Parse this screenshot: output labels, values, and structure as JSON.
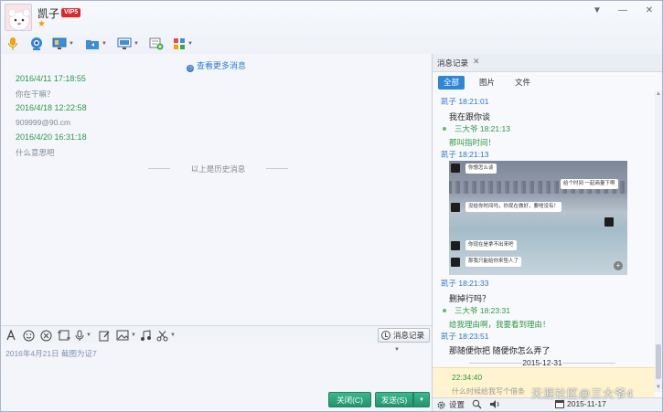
{
  "window": {
    "contact_name": "凯子",
    "vip_label": "VIP5",
    "controls": [
      "▼",
      "—",
      "✕"
    ]
  },
  "toolbar": {
    "items": [
      "voice-call",
      "video-call",
      "remote-desktop",
      "send-file",
      "screen-share",
      "add-app",
      "app-grid"
    ]
  },
  "chat": {
    "more_messages": "查看更多消息",
    "messages": [
      {
        "time": "2016/4/11 17:18:55",
        "text": "你在干嘛？"
      },
      {
        "time": "2016/4/18 12:22:58",
        "text": "909999@90.cm"
      },
      {
        "time": "2016/4/20 16:31:18",
        "text": "什么意思吧"
      }
    ],
    "history_separator": "以上是历史消息"
  },
  "input": {
    "history_button": "消息记录",
    "draft_text": "2016年4月21日  截图为证7",
    "close_button": "关闭(C)",
    "send_button": "发送(S)"
  },
  "history_panel": {
    "tab_label": "消息记录",
    "filters": [
      "全部",
      "图片",
      "文件"
    ],
    "entries": [
      {
        "sender": "凯子 18:21:01",
        "text": "我在跟你谈",
        "side": "them"
      },
      {
        "sender": "三大爷 18:21:13",
        "text": "那叫指时间！",
        "side": "me"
      },
      {
        "sender": "凯子 18:21:13",
        "text": "",
        "side": "them"
      },
      {
        "sender": "凯子 18:21:33",
        "text": "删掉行吗？",
        "side": "them"
      },
      {
        "sender": "三大爷 18:23:31",
        "text": "给我理由啊，我要看到理由！",
        "side": "me"
      },
      {
        "sender": "凯子 18:23:51",
        "text": "那随便你把 随便你怎么弄了",
        "side": "them"
      }
    ],
    "photo_bubbles": [
      "你想怎么谈",
      "给个时间 一起商量下啊",
      "没给你时间吗，你现在做好，要啥没有！",
      "你现在是拿不出来吧",
      "那我只能给你来垫人了"
    ],
    "date_separator": "2015-12-31",
    "highlight": {
      "time": "22:34:40",
      "text": "什么时候给我写个借条"
    },
    "bottom": {
      "settings_label": "设置",
      "date_label": "2015-11-17"
    }
  },
  "watermark": "天涯社区@三大爷4",
  "colors": {
    "accent": "#2f86d6",
    "green": "#2b9a43",
    "button": "#24946c"
  }
}
